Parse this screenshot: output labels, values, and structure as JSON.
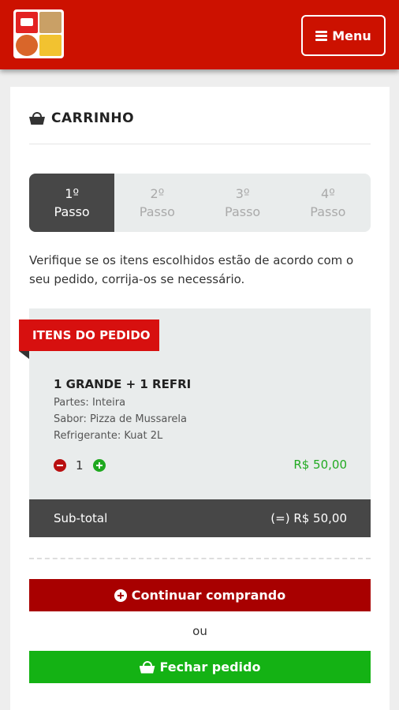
{
  "header": {
    "menu_label": "Menu"
  },
  "cart": {
    "title": "CARRINHO"
  },
  "steps": [
    {
      "number": "1º",
      "label": "Passo",
      "active": true
    },
    {
      "number": "2º",
      "label": "Passo",
      "active": false
    },
    {
      "number": "3º",
      "label": "Passo",
      "active": false
    },
    {
      "number": "4º",
      "label": "Passo",
      "active": false
    }
  ],
  "intro_text": "Verifique se os itens escolhidos estão de acordo com o seu pedido, corrija-os se necessário.",
  "order": {
    "section_label": "ITENS DO PEDIDO",
    "item": {
      "name": "1 GRANDE + 1 REFRI",
      "details": [
        "Partes: Inteira",
        "Sabor: Pizza de Mussarela",
        "Refrigerante: Kuat 2L"
      ],
      "quantity": "1",
      "price": "R$ 50,00"
    },
    "subtotal_label": "Sub-total",
    "subtotal_value": "(=) R$ 50,00"
  },
  "actions": {
    "continue_label": "Continuar comprando",
    "or_label": "ou",
    "close_label": "Fechar pedido"
  },
  "colors": {
    "brand_red": "#cc1100",
    "ribbon_red": "#d7100f",
    "continue_red": "#a80000",
    "success_green": "#14b214",
    "dark_gray": "#474747"
  }
}
